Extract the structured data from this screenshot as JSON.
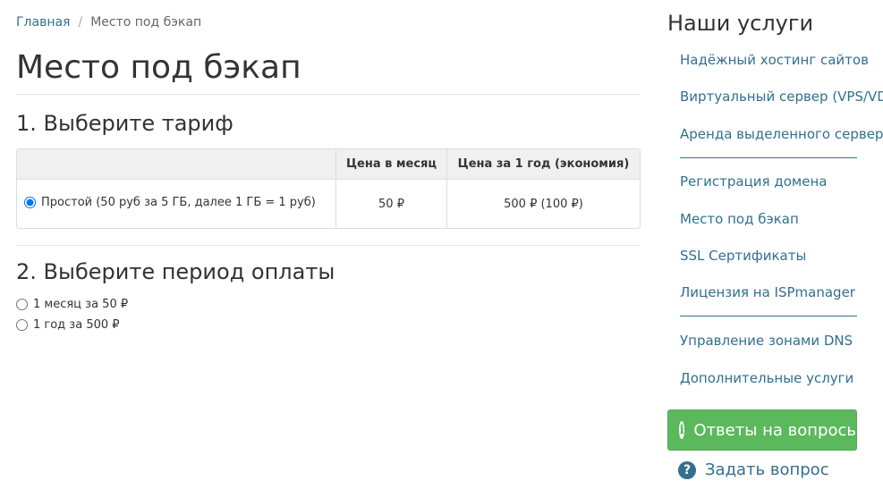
{
  "breadcrumb": {
    "home": "Главная",
    "separator": "/",
    "current": "Место под бэкап"
  },
  "page": {
    "title": "Место под бэкап"
  },
  "step1": {
    "title": "1. Выберите тариф",
    "columns": [
      "",
      "Цена в месяц",
      "Цена за 1 год (экономия)"
    ],
    "rows": [
      {
        "name": "Простой (50 руб за 5 ГБ, далее 1 ГБ = 1 руб)",
        "monthly": "50 ₽",
        "yearly": "500 ₽ (100 ₽)",
        "selected": true
      }
    ]
  },
  "step2": {
    "title": "2. Выберите период оплаты",
    "options": [
      {
        "label": "1 месяц за 50 ₽",
        "selected": false
      },
      {
        "label": "1 год за 500 ₽",
        "selected": false
      }
    ]
  },
  "sidebar": {
    "title": "Наши услуги",
    "links": [
      "Надёжный хостинг сайтов",
      "Виртуальный сервер (VPS/VDS)",
      "Аренда выделенного сервера",
      "Регистрация домена",
      "Место под бэкап",
      "SSL Сертификаты",
      "Лицензия на ISPmanager",
      "Управление зонами DNS",
      "Дополнительные услуги"
    ],
    "faq_button": "Ответы на вопрось",
    "ask_link": "Задать вопрос"
  },
  "colors": {
    "link": "#31708f",
    "success": "#5cb85c"
  },
  "icons": {
    "faq": "info-icon",
    "ask": "question-icon"
  }
}
